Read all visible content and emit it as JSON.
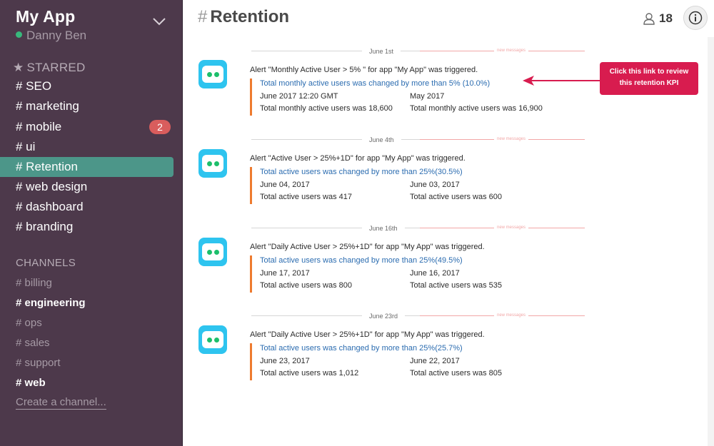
{
  "team": {
    "name": "My App",
    "user": "Danny Ben"
  },
  "sidebar": {
    "starred_title": "STARRED",
    "starred": [
      {
        "label": "# SEO"
      },
      {
        "label": "# marketing"
      },
      {
        "label": "# mobile",
        "badge": "2"
      },
      {
        "label": "# ui"
      },
      {
        "label": "# Retention"
      },
      {
        "label": "# web design"
      },
      {
        "label": "# dashboard"
      },
      {
        "label": "# branding"
      }
    ],
    "channels_title": "CHANNELS",
    "channels": [
      {
        "hash": "#",
        "name": "billing"
      },
      {
        "hash": "#",
        "name": "engineering"
      },
      {
        "hash": "#",
        "name": "ops"
      },
      {
        "hash": "#",
        "name": "sales"
      },
      {
        "hash": "#",
        "name": "support"
      },
      {
        "hash": "#",
        "name": "web"
      }
    ],
    "create_channel": "Create a channel..."
  },
  "header": {
    "hash": "#",
    "title": "Retention",
    "member_count": "18"
  },
  "new_messages_label": "new messages",
  "messages": [
    {
      "date": "June 1st",
      "title": "Alert \"Monthly Active User > 5% \" for app \"My App\" was triggered.",
      "link": "Total monthly active users was changed by more than 5% (10.0%)",
      "col1_date": "June 2017  12:20 GMT",
      "col1_value": "Total monthly active users was 18,600",
      "col2_date": "May 2017",
      "col2_value": "Total monthly active users was 16,900"
    },
    {
      "date": "June 4th",
      "title": "Alert  \"Active User > 25%+1D\" for app \"My App\" was triggered.",
      "link": "Total active users was changed by more than 25%(30.5%)",
      "col1_date": "June 04, 2017",
      "col1_value": "Total active users was 417",
      "col2_date": "June 03, 2017",
      "col2_value": "Total active users was 600"
    },
    {
      "date": "June 16th",
      "title": "Alert \"Daily Active User > 25%+1D\" for app \"My App\" was triggered.",
      "link": " Total active users was changed by more than 25%(49.5%)",
      "col1_date": "June 17, 2017",
      "col1_value": "Total active users was 800",
      "col2_date": "June 16, 2017",
      "col2_value": "Total active users was 535"
    },
    {
      "date": "June 23rd",
      "title": "Alert \"Daily Active User > 25%+1D\" for app \"My App\" was triggered.",
      "link": " Total active users was changed by more than 25%(25.7%)",
      "col1_date": "June 23, 2017",
      "col1_value": "Total active users was 1,012",
      "col2_date": "June 22, 2017",
      "col2_value": "Total active users was 805"
    }
  ],
  "callout": {
    "line1": "Click this link to review",
    "line2": "this retention KPI"
  },
  "colors": {
    "sidebar_bg": "#4d394b",
    "active_item": "#4c9689",
    "badge": "#d95d5d",
    "attachment_bar": "#ee7b2f",
    "link": "#2b6cb0",
    "callout": "#d81c4f",
    "avatar": "#2ec4ef"
  }
}
